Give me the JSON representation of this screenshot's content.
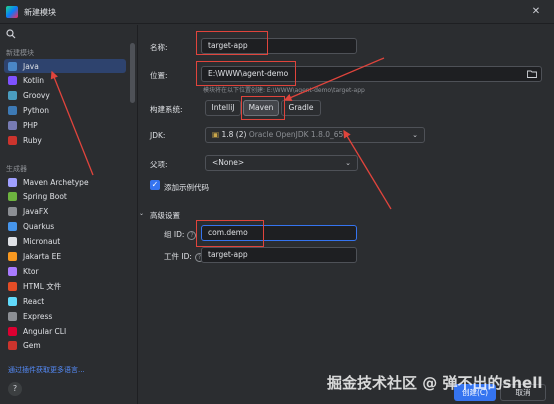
{
  "window": {
    "title": "新建模块",
    "close_glyph": "✕"
  },
  "sidebar": {
    "section_new": "新建模块",
    "section_generators": "生成器",
    "items_new": [
      {
        "label": "Java",
        "icon": "java-icon",
        "color": "#4a86c7",
        "selected": true
      },
      {
        "label": "Kotlin",
        "icon": "kotlin-icon",
        "color": "#7f52ff"
      },
      {
        "label": "Groovy",
        "icon": "groovy-icon",
        "color": "#4a9cbe"
      },
      {
        "label": "Python",
        "icon": "python-icon",
        "color": "#3d7ab5"
      },
      {
        "label": "PHP",
        "icon": "php-icon",
        "color": "#777bb3"
      },
      {
        "label": "Ruby",
        "icon": "ruby-icon",
        "color": "#cc342d"
      }
    ],
    "items_generators": [
      {
        "label": "Maven Archetype",
        "icon": "maven-icon",
        "color": "#a0a0ff"
      },
      {
        "label": "Spring Boot",
        "icon": "spring-icon",
        "color": "#6db33f"
      },
      {
        "label": "JavaFX",
        "icon": "javafx-icon",
        "color": "#8c8f94"
      },
      {
        "label": "Quarkus",
        "icon": "quarkus-icon",
        "color": "#4695eb"
      },
      {
        "label": "Micronaut",
        "icon": "micronaut-icon",
        "color": "#dfe1e5"
      },
      {
        "label": "Jakarta EE",
        "icon": "jakarta-icon",
        "color": "#f89820"
      },
      {
        "label": "Ktor",
        "icon": "ktor-icon",
        "color": "#a97bff"
      },
      {
        "label": "HTML 文件",
        "icon": "html-icon",
        "color": "#e44d26"
      },
      {
        "label": "React",
        "icon": "react-icon",
        "color": "#61dafb"
      },
      {
        "label": "Express",
        "icon": "express-icon",
        "color": "#8c8f94"
      },
      {
        "label": "Angular CLI",
        "icon": "angular-icon",
        "color": "#dd0031"
      },
      {
        "label": "Gem",
        "icon": "gem-icon",
        "color": "#cc342d"
      }
    ],
    "plugin_link": "通过插件获取更多语言...",
    "help_glyph": "?"
  },
  "form": {
    "name_label": "名称:",
    "name_value": "target-app",
    "location_label": "位置:",
    "location_value": "E:\\WWW\\agent-demo",
    "location_hint": "模块将在以下位置创建: E:\\WWW\\agent-demo\\target-app",
    "build_label": "构建系统:",
    "build_options": [
      "IntelliJ",
      "Maven",
      "Gradle"
    ],
    "jdk_label": "JDK:",
    "jdk_value": "1.8 (2)",
    "jdk_detail": "Oracle OpenJDK 1.8.0_65",
    "parent_label": "父项:",
    "parent_value": "<None>",
    "sample_label": "添加示例代码",
    "advanced_label": "高级设置",
    "group_label": "组 ID:",
    "group_value": "com.demo",
    "artifact_label": "工件 ID:",
    "artifact_value": "target-app"
  },
  "buttons": {
    "create": "创建(C)",
    "cancel": "取消"
  },
  "watermark": "掘金技术社区 @ 弹不出的shell",
  "colors": {
    "accent": "#3574f0",
    "annotation": "#e0443c",
    "background": "#2b2d30"
  }
}
